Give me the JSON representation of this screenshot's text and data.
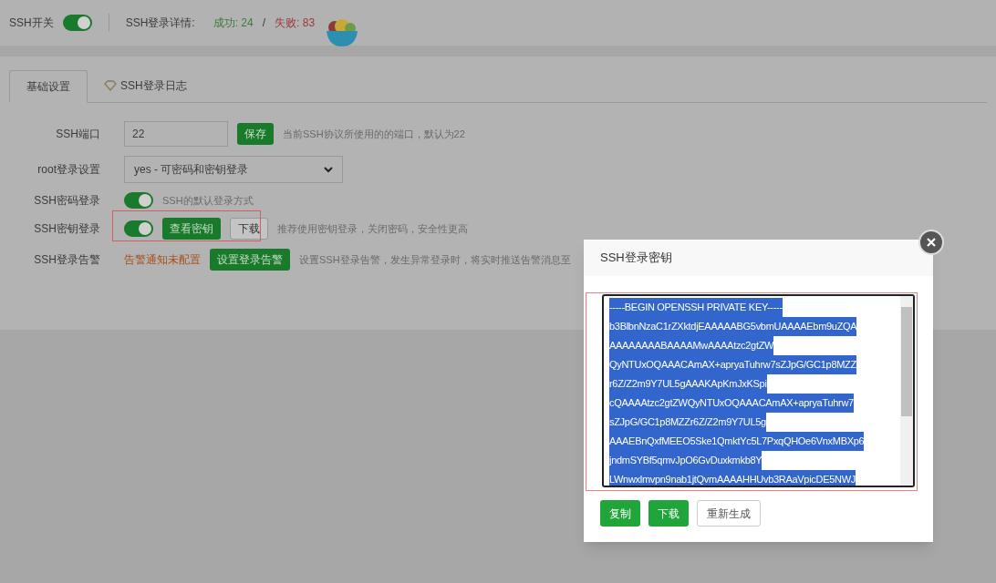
{
  "header": {
    "switch_label": "SSH开关",
    "switch_on": true,
    "details_label": "SSH登录详情:",
    "success": "成功: 24",
    "separator": "/",
    "failure": "失败: 83"
  },
  "tabs": [
    {
      "label": "基础设置",
      "selected": true,
      "icon": false
    },
    {
      "label": "SSH登录日志",
      "selected": false,
      "icon": true
    }
  ],
  "settings": [
    {
      "kind": "input",
      "label": "SSH端口",
      "value": "22",
      "buttons": [
        {
          "label": "保存",
          "primary": true
        }
      ],
      "hint": "当前SSH协议所使用的的端口，默认为22"
    },
    {
      "kind": "select",
      "label": "root登录设置",
      "value": "yes - 可密码和密钥登录"
    },
    {
      "kind": "toggle",
      "label": "SSH密码登录",
      "on": true,
      "hint": "SSH的默认登录方式"
    },
    {
      "kind": "toggle",
      "label": "SSH密钥登录",
      "on": true,
      "buttons": [
        {
          "label": "查看密钥",
          "primary": true
        },
        {
          "label": "下载",
          "primary": false
        }
      ],
      "hint": "推荐使用密钥登录，关闭密码，安全性更高",
      "highlighted": true
    },
    {
      "kind": "alert",
      "label": "SSH登录告警",
      "status": "告警通知未配置",
      "buttons": [
        {
          "label": "设置登录告警",
          "primary": true
        }
      ],
      "hint": "设置SSH登录告警，发生异常登录时，将实时推送告警消息至"
    }
  ],
  "dialog": {
    "title": "SSH登录密钥",
    "key_lines": [
      "-----BEGIN OPENSSH PRIVATE KEY-----",
      "b3BlbnNzaC1rZXktdjEAAAAABG5vbmUAAAAEbm9uZQA",
      "AAAAAAAABAAAAMwAAAAtzc2gtZW",
      "QyNTUxOQAAACAmAX+apryaTuhrw7sZJpG/GC1p8MZZ",
      "r6Z/Z2m9Y7UL5gAAAKApKmJxKSpi",
      "cQAAAAtzc2gtZWQyNTUxOQAAACAmAX+apryaTuhrw7",
      "sZJpG/GC1p8MZZr6Z/Z2m9Y7UL5g",
      "AAAEBnQxfMEEO5Ske1QmktYc5L7PxqQHOe6VnxMBXp6",
      "jndmSYBf5qmvJpO6GvDuxkmkb8Y",
      "LWnwxlmvpn9nab1jtQvmAAAAHHUvb3RAaVpicDE5NWJ"
    ],
    "key_selected": true,
    "highlighted": true,
    "buttons": [
      {
        "label": "复制",
        "primary": true
      },
      {
        "label": "下载",
        "primary": true
      },
      {
        "label": "重新生成",
        "primary": false
      }
    ]
  }
}
